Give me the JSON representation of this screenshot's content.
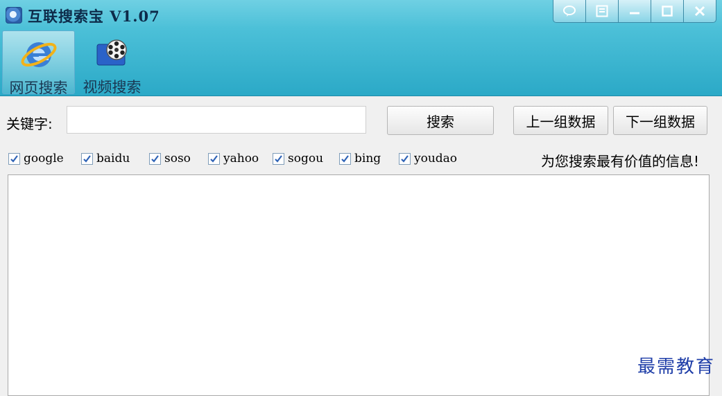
{
  "app": {
    "title": "互联搜索宝 V1.07"
  },
  "system_buttons": [
    {
      "icon": "chat-bubble-icon"
    },
    {
      "icon": "menu-icon"
    },
    {
      "icon": "minimize-icon"
    },
    {
      "icon": "maximize-icon"
    },
    {
      "icon": "close-icon"
    }
  ],
  "nav": {
    "web_search_label": "网页搜索",
    "video_search_label": "视频搜索",
    "active": "网页搜索"
  },
  "search": {
    "keyword_label": "关键字:",
    "keyword_value": "",
    "search_button": "搜索",
    "prev_button": "上一组数据",
    "next_button": "下一组数据"
  },
  "engines": [
    {
      "label": "google",
      "checked": true
    },
    {
      "label": "baidu",
      "checked": true
    },
    {
      "label": "soso",
      "checked": true
    },
    {
      "label": "yahoo",
      "checked": true
    },
    {
      "label": "sogou",
      "checked": true
    },
    {
      "label": "bing",
      "checked": true
    },
    {
      "label": "youdao",
      "checked": true
    }
  ],
  "slogan": "为您搜索最有价值的信息!",
  "watermark": "最需教育",
  "colors": {
    "titlebar": "#2ba9c7",
    "check": "#2f63b6",
    "watermark": "#1f3ea8"
  }
}
